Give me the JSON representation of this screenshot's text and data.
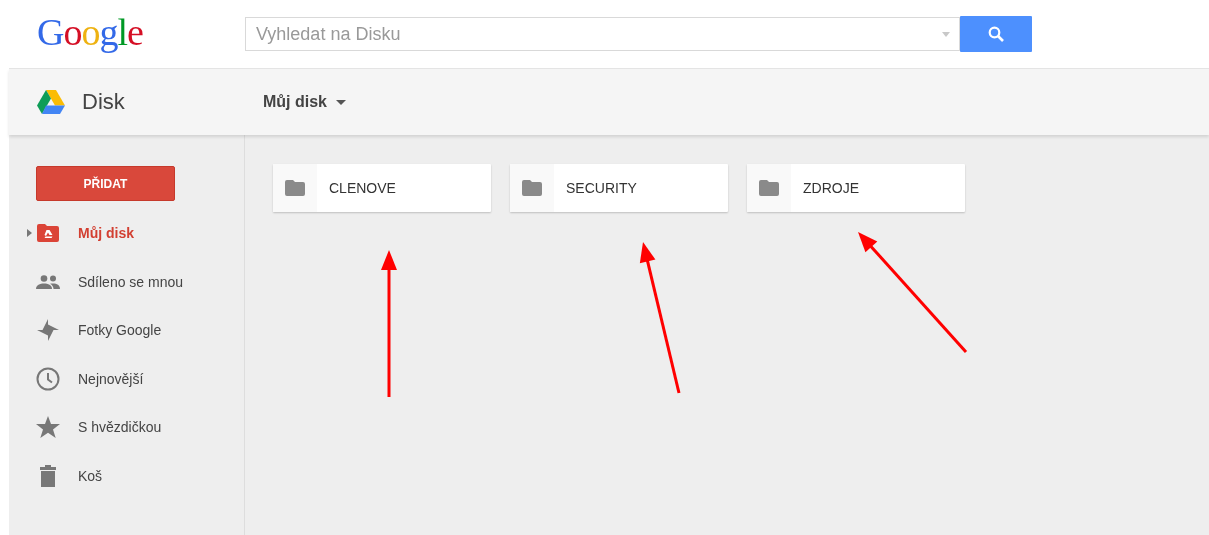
{
  "logo": {
    "text": "Google"
  },
  "search": {
    "placeholder": "Vyhledat na Disku"
  },
  "app": {
    "name": "Disk"
  },
  "location": {
    "label": "Můj disk"
  },
  "new_button": {
    "label": "PŘIDAT"
  },
  "sidebar": {
    "items": [
      {
        "label": "Můj disk",
        "selected": true,
        "expandable": true
      },
      {
        "label": "Sdíleno se mnou",
        "selected": false,
        "expandable": false
      },
      {
        "label": "Fotky Google",
        "selected": false,
        "expandable": false
      },
      {
        "label": "Nejnovější",
        "selected": false,
        "expandable": false
      },
      {
        "label": "S hvězdičkou",
        "selected": false,
        "expandable": false
      },
      {
        "label": "Koš",
        "selected": false,
        "expandable": false
      }
    ]
  },
  "folders": [
    {
      "name": "CLENOVE"
    },
    {
      "name": "SECURITY"
    },
    {
      "name": "ZDROJE"
    }
  ]
}
